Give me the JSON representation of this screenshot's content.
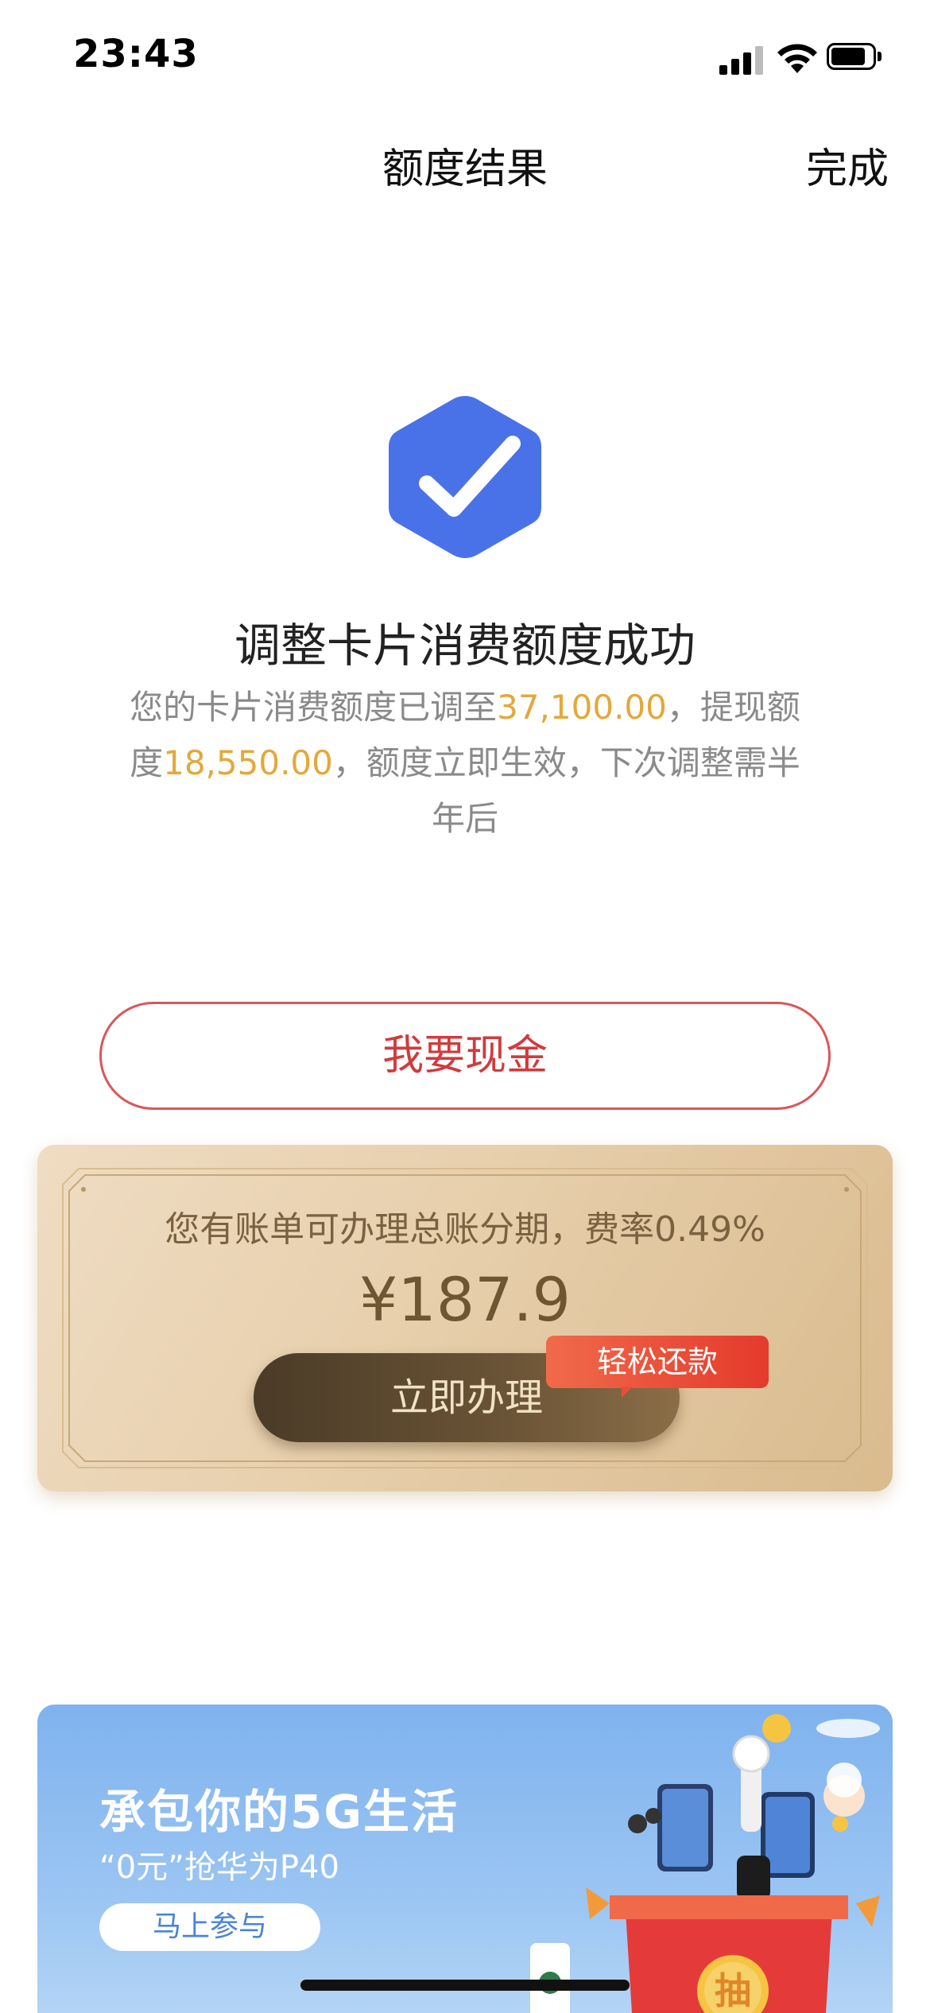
{
  "status_bar": {
    "time": "23:43"
  },
  "nav": {
    "title": "额度结果",
    "done_label": "完成"
  },
  "result": {
    "title": "调整卡片消费额度成功",
    "desc_part1": "您的卡片消费额度已调至",
    "consume_limit": "37,100.00",
    "desc_part2": "，提现额度",
    "cash_limit": "18,550.00",
    "desc_part3": "，额度立即生效，下次调整需半年后"
  },
  "cash_button": {
    "label": "我要现金"
  },
  "installment": {
    "text": "您有账单可办理总账分期，费率0.49%",
    "amount": "¥187.9",
    "button_label": "立即办理",
    "badge": "轻松还款"
  },
  "promo": {
    "title": "承包你的5G生活",
    "subtitle": "“0元”抢华为P40",
    "button_label": "马上参与",
    "lottery_char": "抽"
  },
  "colors": {
    "success_icon": "#4a72e8",
    "highlight": "#e3a83a",
    "cash_button": "#d23a3c",
    "badge": "#e53a2c",
    "promo_bg": "#8bbcf0"
  }
}
